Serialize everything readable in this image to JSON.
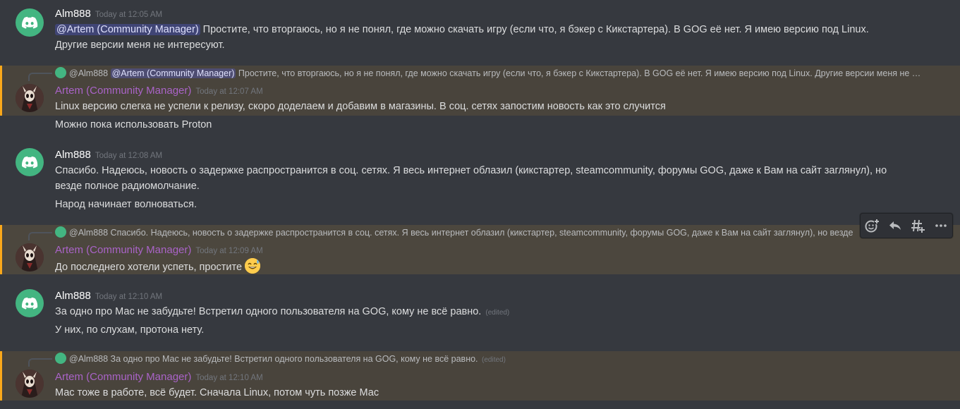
{
  "messages": [
    {
      "username": "Alm888",
      "timestamp": "Today at 12:05 AM",
      "mention": "@Artem (Community Manager)",
      "line1_rest": " Простите, что вторгаюсь, но я не понял, где можно скачать игру (если что, я бэкер с Кикстартера). В GOG её нет. Я имею версию под Linux.",
      "line2": "Другие версии меня не интересуют."
    },
    {
      "reply": {
        "author": "@Alm888",
        "mention": "@Artem (Community Manager)",
        "text": " Простите, что вторгаюсь, но я не понял, где можно скачать игру (если что, я бэкер с Кикстартера). В GOG её нет. Я имею версию под Linux. Другие версии меня не интересуют."
      },
      "username": "Artem (Community Manager)",
      "timestamp": "Today at 12:07 AM",
      "line1": "Linux версию слегка не успели к релизу, скоро доделаем и добавим в магазины. В соц. сетях запостим новость как это случится",
      "line2": "Можно пока использовать Proton"
    },
    {
      "username": "Alm888",
      "timestamp": "Today at 12:08 AM",
      "line1": "Спасибо. Надеюсь, новость о задержке распространится в соц. сетях. Я весь интернет облазил (кикстартер, steamcommunity, форумы GOG, даже к Вам на сайт заглянул), но",
      "line2": "везде полное радиомолчание.",
      "line3": "Народ начинает волноваться."
    },
    {
      "reply": {
        "author": "@Alm888",
        "text": " Спасибо. Надеюсь, новость о задержке распространится в соц. сетях. Я весь интернет облазил (кикстартер, steamcommunity, форумы GOG, даже к Вам на сайт заглянул), но везде"
      },
      "username": "Artem (Community Manager)",
      "timestamp": "Today at 12:09 AM",
      "line1": "До последнего хотели успеть, простите",
      "emoji": "sweat-smile-emoji"
    },
    {
      "username": "Alm888",
      "timestamp": "Today at 12:10 AM",
      "line1": "За одно про Мас не забудьте! Встретил одного пользователя на GOG, кому не всё равно.",
      "edited": "(edited)",
      "line2": "У них, по слухам, протона нету."
    },
    {
      "reply": {
        "author": "@Alm888",
        "text": " За одно про Мас не забудьте! Встретил одного пользователя на GOG, кому не всё равно.",
        "edited": "(edited)"
      },
      "username": "Artem (Community Manager)",
      "timestamp": "Today at 12:10 AM",
      "line1": "Мас тоже в работе, всё будет. Сначала Linux, потом чуть позже Мас"
    }
  ],
  "toolbar": {
    "icons": [
      "add-reaction-icon",
      "reply-icon",
      "create-thread-icon",
      "more-icon"
    ]
  },
  "colors": {
    "background": "#36393f",
    "mention_highlight": "#49443c",
    "mention_bar": "#faa81a",
    "community_manager": "#a963c7",
    "discord_green": "#43b581"
  }
}
